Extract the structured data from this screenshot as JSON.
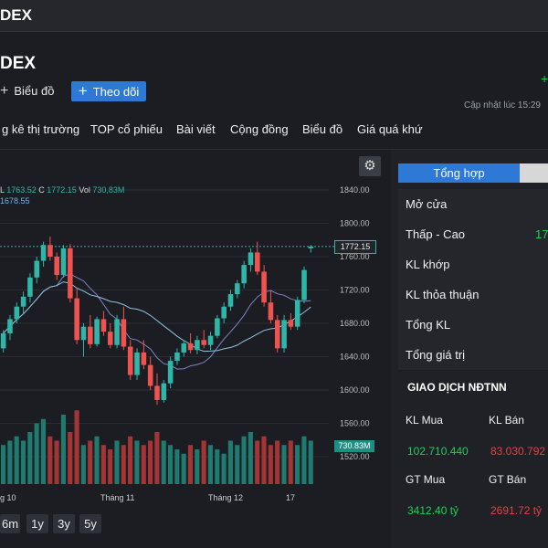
{
  "header": {
    "title": "DEX"
  },
  "stock": {
    "name": "DEX"
  },
  "buttons": {
    "chart": "Biểu đồ",
    "follow": "Theo dõi"
  },
  "updated": "Cập nhật lúc  15:29",
  "tabs": [
    "g kê thị trường",
    "TOP cổ phiếu",
    "Bài viết",
    "Cộng đồng",
    "Biểu đồ",
    "Giá quá khứ"
  ],
  "ohlc": {
    "l_label": "L",
    "l": "1763.52",
    "c_label": "C",
    "c": "1772.15",
    "vol_label": "Vol",
    "vol": "730,83M",
    "ma": "1678.55"
  },
  "chart_labels": {
    "price_box": "1772.15",
    "vol_box": "730.83M"
  },
  "range_buttons": [
    "6m",
    "1y",
    "3y",
    "5y"
  ],
  "panel": {
    "tab": "Tổng hợp",
    "rows": [
      {
        "label": "Mở cửa",
        "value": ""
      },
      {
        "label": "Thấp - Cao",
        "value": "17"
      },
      {
        "label": "KL khớp",
        "value": ""
      },
      {
        "label": "KL thỏa thuận",
        "value": ""
      },
      {
        "label": "Tổng KL",
        "value": ""
      },
      {
        "label": "Tổng giá trị",
        "value": ""
      }
    ],
    "section": "GIAO DỊCH NĐTNN",
    "kl_mua_label": "KL Mua",
    "kl_ban_label": "KL Bán",
    "kl_mua": "102.710.440",
    "kl_ban": "83.030.792",
    "gt_mua_label": "GT Mua",
    "gt_ban_label": "GT Bán",
    "gt_mua": "3412.40 tỷ",
    "gt_ban": "2691.72 tỷ"
  },
  "chart_data": {
    "type": "candlestick",
    "y_ticks": [
      "1840.00",
      "1800.00",
      "1760.00",
      "1720.00",
      "1680.00",
      "1640.00",
      "1600.00",
      "1560.00",
      "1520.00"
    ],
    "y_values": [
      1840,
      1800,
      1760,
      1720,
      1680,
      1640,
      1600,
      1560,
      1520
    ],
    "x_ticks": [
      "g 10",
      "Tháng 11",
      "Tháng 12",
      "17"
    ],
    "last_close": 1772.15,
    "candles": [
      [
        1650,
        1672,
        1645,
        1668
      ],
      [
        1668,
        1690,
        1660,
        1685
      ],
      [
        1685,
        1705,
        1680,
        1700
      ],
      [
        1700,
        1718,
        1692,
        1712
      ],
      [
        1712,
        1740,
        1705,
        1735
      ],
      [
        1735,
        1760,
        1728,
        1755
      ],
      [
        1755,
        1778,
        1748,
        1774
      ],
      [
        1774,
        1784,
        1755,
        1760
      ],
      [
        1760,
        1765,
        1732,
        1738
      ],
      [
        1738,
        1774,
        1735,
        1770
      ],
      [
        1770,
        1775,
        1705,
        1710
      ],
      [
        1710,
        1722,
        1655,
        1660
      ],
      [
        1660,
        1680,
        1640,
        1676
      ],
      [
        1676,
        1690,
        1650,
        1655
      ],
      [
        1655,
        1688,
        1652,
        1685
      ],
      [
        1685,
        1695,
        1665,
        1670
      ],
      [
        1670,
        1680,
        1650,
        1654
      ],
      [
        1654,
        1690,
        1650,
        1685
      ],
      [
        1685,
        1700,
        1648,
        1652
      ],
      [
        1652,
        1660,
        1612,
        1618
      ],
      [
        1618,
        1650,
        1612,
        1645
      ],
      [
        1645,
        1660,
        1625,
        1630
      ],
      [
        1630,
        1640,
        1600,
        1605
      ],
      [
        1605,
        1620,
        1582,
        1588
      ],
      [
        1588,
        1612,
        1585,
        1608
      ],
      [
        1608,
        1640,
        1602,
        1635
      ],
      [
        1635,
        1650,
        1630,
        1645
      ],
      [
        1645,
        1660,
        1640,
        1656
      ],
      [
        1656,
        1668,
        1644,
        1648
      ],
      [
        1648,
        1665,
        1643,
        1660
      ],
      [
        1660,
        1672,
        1650,
        1654
      ],
      [
        1654,
        1670,
        1648,
        1665
      ],
      [
        1665,
        1690,
        1662,
        1686
      ],
      [
        1686,
        1705,
        1680,
        1700
      ],
      [
        1700,
        1720,
        1695,
        1715
      ],
      [
        1715,
        1732,
        1710,
        1728
      ],
      [
        1728,
        1755,
        1722,
        1750
      ],
      [
        1750,
        1770,
        1742,
        1765
      ],
      [
        1765,
        1778,
        1738,
        1742
      ],
      [
        1742,
        1750,
        1700,
        1705
      ],
      [
        1705,
        1720,
        1680,
        1684
      ],
      [
        1684,
        1690,
        1645,
        1650
      ],
      [
        1650,
        1690,
        1645,
        1684
      ],
      [
        1684,
        1692,
        1672,
        1676
      ],
      [
        1676,
        1712,
        1672,
        1708
      ],
      [
        1708,
        1748,
        1704,
        1744
      ],
      [
        1770,
        1774,
        1765,
        1772
      ]
    ],
    "volumes": [
      0.45,
      0.5,
      0.55,
      0.5,
      0.6,
      0.7,
      0.75,
      0.55,
      0.5,
      0.8,
      0.6,
      0.85,
      0.45,
      0.5,
      0.55,
      0.45,
      0.4,
      0.5,
      0.45,
      0.55,
      0.5,
      0.45,
      0.5,
      0.6,
      0.5,
      0.45,
      0.4,
      0.35,
      0.45,
      0.4,
      0.5,
      0.45,
      0.4,
      0.35,
      0.5,
      0.45,
      0.55,
      0.6,
      0.5,
      0.55,
      0.45,
      0.5,
      0.45,
      0.5,
      0.45,
      0.55,
      0.5
    ]
  }
}
